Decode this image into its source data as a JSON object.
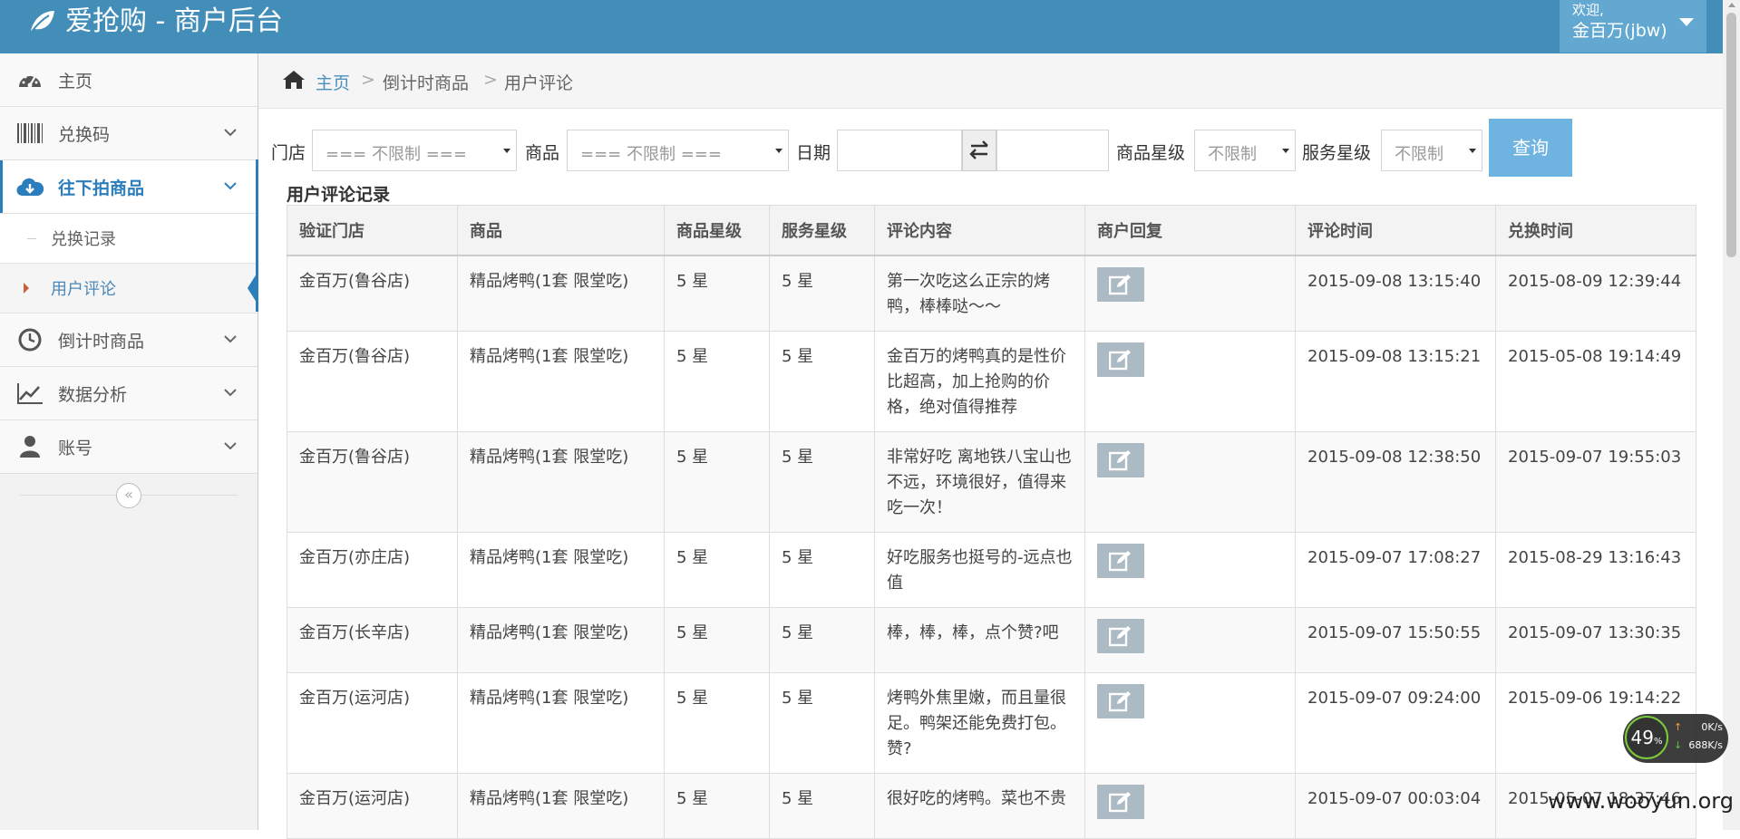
{
  "app": {
    "title": "爱抢购 - 商户后台",
    "welcome": "欢迎,",
    "username": "金百万(jbw)",
    "accent_color": "#438eb9"
  },
  "sidebar": {
    "items": [
      {
        "label": "主页",
        "icon": "dashboard-icon"
      },
      {
        "label": "兑换码",
        "icon": "barcode-icon"
      },
      {
        "label": "往下拍商品",
        "icon": "cloud-download-icon"
      },
      {
        "label": "倒计时商品",
        "icon": "clock-icon"
      },
      {
        "label": "数据分析",
        "icon": "chart-icon"
      },
      {
        "label": "账号",
        "icon": "user-icon"
      }
    ],
    "sub_items": [
      "兑换记录",
      "用户评论"
    ],
    "collapse_glyph": "«"
  },
  "breadcrumb": {
    "home": "主页",
    "sep": ">",
    "middle": "倒计时商品",
    "current": "用户评论"
  },
  "filters": {
    "store_label": "门店",
    "store_value": "=== 不限制 ===",
    "product_label": "商品",
    "product_value": "=== 不限制 ===",
    "date_label": "日期",
    "product_rating_label": "商品星级",
    "product_rating_value": "不限制",
    "service_rating_label": "服务星级",
    "service_rating_value": "不限制",
    "query_button": "查询"
  },
  "table": {
    "title": "用户评论记录",
    "headers": [
      "验证门店",
      "商品",
      "商品星级",
      "服务星级",
      "评论内容",
      "商户回复",
      "评论时间",
      "兑换时间"
    ],
    "rows": [
      {
        "store": "金百万(鲁谷店)",
        "product": "精品烤鸭(1套 限堂吃)",
        "prating": "5 星",
        "srating": "5 星",
        "comment": "第一次吃这么正宗的烤鸭，棒棒哒～～",
        "ctime": "2015-09-08 13:15:40",
        "etime": "2015-08-09 12:39:44"
      },
      {
        "store": "金百万(鲁谷店)",
        "product": "精品烤鸭(1套 限堂吃)",
        "prating": "5 星",
        "srating": "5 星",
        "comment": "金百万的烤鸭真的是性价比超高，加上抢购的价格，绝对值得推荐",
        "ctime": "2015-09-08 13:15:21",
        "etime": "2015-05-08 19:14:49"
      },
      {
        "store": "金百万(鲁谷店)",
        "product": "精品烤鸭(1套 限堂吃)",
        "prating": "5 星",
        "srating": "5 星",
        "comment": "非常好吃 离地铁八宝山也不远，环境很好，值得来吃一次！",
        "ctime": "2015-09-08 12:38:50",
        "etime": "2015-09-07 19:55:03"
      },
      {
        "store": "金百万(亦庄店)",
        "product": "精品烤鸭(1套 限堂吃)",
        "prating": "5 星",
        "srating": "5 星",
        "comment": "好吃服务也挺号的-远点也值",
        "ctime": "2015-09-07 17:08:27",
        "etime": "2015-08-29 13:16:43"
      },
      {
        "store": "金百万(长辛店)",
        "product": "精品烤鸭(1套 限堂吃)",
        "prating": "5 星",
        "srating": "5 星",
        "comment": "棒，棒，棒，点个赞?吧",
        "ctime": "2015-09-07 15:50:55",
        "etime": "2015-09-07 13:30:35"
      },
      {
        "store": "金百万(运河店)",
        "product": "精品烤鸭(1套 限堂吃)",
        "prating": "5 星",
        "srating": "5 星",
        "comment": "烤鸭外焦里嫩，而且量很足。鸭架还能免费打包。赞?",
        "ctime": "2015-09-07 09:24:00",
        "etime": "2015-09-06 19:14:22"
      },
      {
        "store": "金百万(运河店)",
        "product": "精品烤鸭(1套 限堂吃)",
        "prating": "5 星",
        "srating": "5 星",
        "comment": "很好吃的烤鸭。菜也不贵",
        "ctime": "2015-09-07 00:03:04",
        "etime": "2015-05-07 18:37:46"
      }
    ]
  },
  "net_widget": {
    "percent": "49",
    "percent_unit": "%",
    "up_speed": "0K/s",
    "down_speed": "688K/s"
  },
  "watermark": "www.wooyun.org"
}
